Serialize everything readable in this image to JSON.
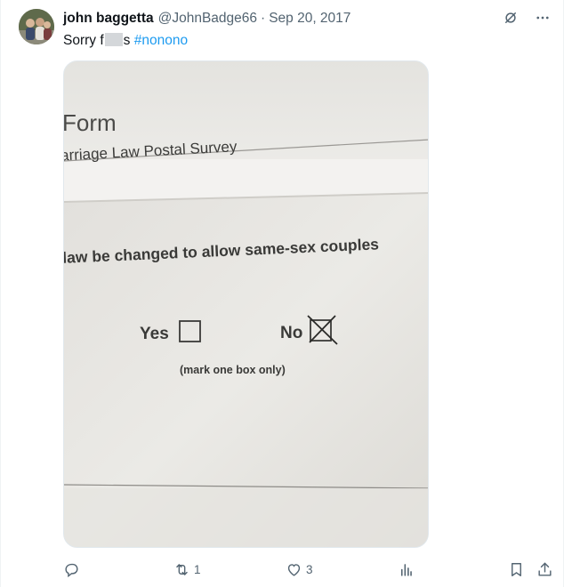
{
  "tweet": {
    "display_name": "john baggetta",
    "handle": "@JohnBadge66",
    "separator": "·",
    "date": "Sep 20, 2017",
    "text_before": "Sorry f",
    "text_after": "s",
    "hashtag": "#nonono"
  },
  "photo": {
    "form_title": "Form",
    "survey_title": "arriage Law Postal Survey",
    "question": "law be changed to allow same-sex couples",
    "yes_label": "Yes",
    "no_label": "No",
    "instruction": "(mark one box only)",
    "selected_option": "No"
  },
  "actions": {
    "reply_count": "",
    "retweet_count": "1",
    "like_count": "3"
  },
  "icons": [
    "avatar",
    "grok-icon",
    "more-icon",
    "reply-icon",
    "retweet-icon",
    "like-icon",
    "views-icon",
    "bookmark-icon",
    "share-icon"
  ]
}
